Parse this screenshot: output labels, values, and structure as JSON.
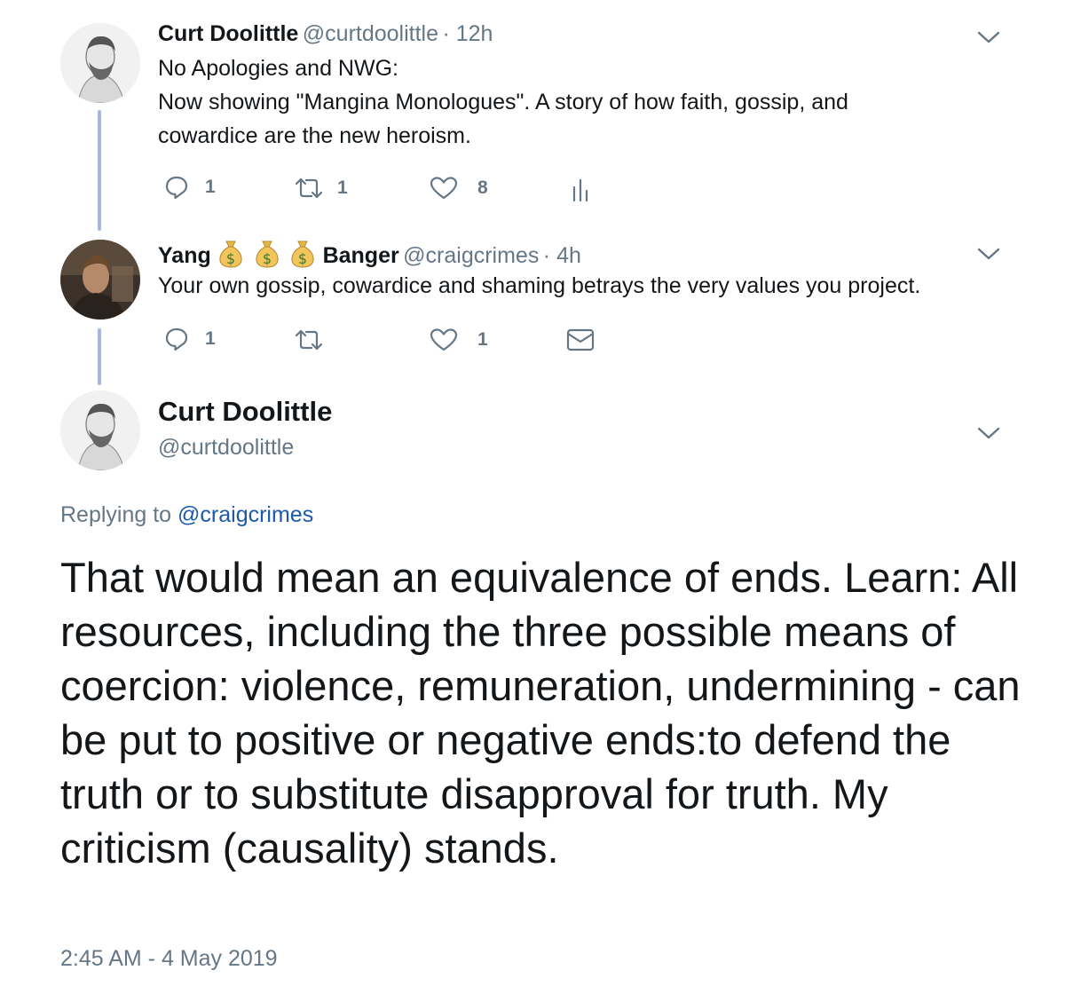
{
  "tweet1": {
    "author_name": "Curt Doolittle",
    "handle": "@curtdoolittle",
    "time": "· 12h",
    "line1": "No Apologies and NWG:",
    "line2": "Now showing \"Mangina Monologues\".  A story of how faith, gossip, and",
    "line3": "cowardice are the new heroism.",
    "reply_count": "1",
    "retweet_count": "1",
    "like_count": "8",
    "icons": [
      "reply-icon",
      "retweet-icon",
      "like-icon",
      "analytics-icon",
      "chevron-down-icon"
    ]
  },
  "tweet2": {
    "name_part1": "Yang",
    "name_emoji": "money-bag ×3",
    "name_part2": "Banger",
    "handle": "@craigcrimes",
    "time": "· 4h",
    "text": "Your own gossip, cowardice and shaming betrays the very values you project.",
    "reply_count": "1",
    "like_count": "1",
    "icons": [
      "reply-icon",
      "retweet-icon",
      "like-icon",
      "mail-icon",
      "chevron-down-icon"
    ]
  },
  "main": {
    "author_name": "Curt Doolittle",
    "handle": "@curtdoolittle",
    "replying_label": "Replying to",
    "replying_handle": "@craigcrimes",
    "text": "That would mean an equivalence of ends. Learn: All resources, including the three possible means of coercion: violence, remuneration, undermining - can be put to positive or negative ends:to defend the truth or to substitute disapproval for truth. My criticism (causality) stands.",
    "timestamp": "2:45 AM - 4 May 2019"
  },
  "colors": {
    "text": "#14171a",
    "muted": "#657786",
    "link": "#1b5aa8",
    "thread_line": "#a3b9e0",
    "money_bag": "#e8b94a"
  }
}
